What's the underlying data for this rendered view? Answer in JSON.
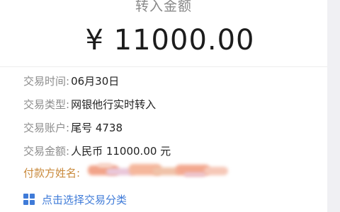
{
  "header": {
    "label": "转入金额",
    "amount": "¥ 11000.00"
  },
  "details": [
    {
      "label": "交易时间:",
      "value": "06月30日"
    },
    {
      "label": "交易类型:",
      "value": "网银他行实时转入"
    },
    {
      "label": "交易账户:",
      "value": "尾号 4738"
    },
    {
      "label": "交易金额:",
      "value": "人民币 11000.00 元"
    }
  ],
  "payer": {
    "label": "付款方姓名:"
  },
  "classify": {
    "label": "点击选择交易分类",
    "icon": "grid-icon"
  },
  "colors": {
    "accent": "#3f7bd8",
    "payer_label": "#c98a3c"
  }
}
